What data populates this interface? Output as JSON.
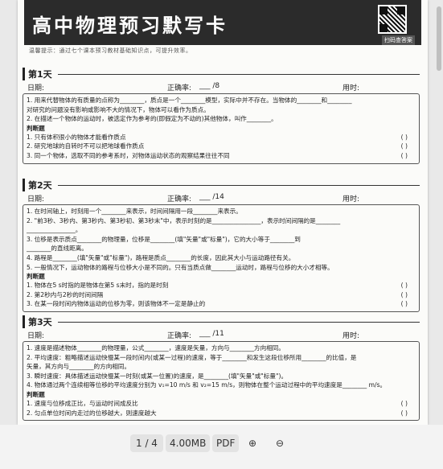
{
  "banner": {
    "title": "高中物理预习默写卡",
    "qr_caption": "扫码查答案",
    "tip": "温馨提示：通过七个课本预习教材基础知识点，可提升效率。"
  },
  "days": [
    {
      "tag": "第1天",
      "date_label": "日期:",
      "score_label": "正确率:",
      "score_value": "___ /8",
      "time_label": "用时:",
      "lines": [
        "1. 用来代替物体的有质量的点称为________，质点是一个________模型，实际中并不存在。当物体的________和________",
        "对研究的问题没有影响或影响不大的情况下，物体可以看作为质点。",
        "2. 在描述一个物体的运动时，被选定作为参考的(即假定为不动的)其他物体，叫作________。"
      ],
      "judge_label": "判断题",
      "judge": [
        "1. 只有体积很小的物体才能看作质点",
        "2. 研究地球的自转时不可以把地球看作质点",
        "3. 同一个物体，选取不同的参考系时，对物体运动状态的观察结果往往不同"
      ]
    },
    {
      "tag": "第2天",
      "date_label": "日期:",
      "score_label": "正确率:",
      "score_value": "___ /14",
      "time_label": "用时:",
      "lines": [
        "1. 在时间轴上，时刻用一个________来表示，时间间隔用一段________来表示。",
        "2. \"前3秒、3秒内、第3秒内、第3秒初、第3秒末\"中，表示时刻的是________________，表示时间间隔的是________",
        "________________。",
        "3. 位移是表示质点________的物理量，位移是________(填\"矢量\"或\"标量\")，它的大小等于________到",
        "________的直线距离。",
        "4. 路程是________(填\"矢量\"或\"标量\")，路程是质点________的长度，因此其大小与运动路径有关。",
        "5. 一般情况下，运动物体的路程与位移大小是不同的。只有当质点做________运动时，路程与位移的大小才相等。"
      ],
      "judge_label": "判断题",
      "judge": [
        "1. 物体在5 s时指的是物体在第5 s末时，指的是时刻",
        "2. 第2秒内与2秒的时间间隔",
        "3. 在某一段时间内物体运动的位移为零，则该物体不一定是静止的"
      ]
    },
    {
      "tag": "第3天",
      "date_label": "日期:",
      "score_label": "正确率:",
      "score_value": "___ /11",
      "time_label": "用时:",
      "lines": [
        "1. 速度是描述物体________的物理量，公式________，速度是矢量，方向与________方向相同。",
        "2. 平均速度：粗略描述运动快慢某一段时间内(或某一过程)的速度，等于________和发生这段位移所用________的比值，是",
        "矢量，其方向与________的方向相同。",
        "3. 瞬时速度：具体描述运动快慢某一时刻(或某一位置)的速度，是________(填\"矢量\"或\"标量\")。",
        "4. 物体通过两个连续相等位移的平均速度分别为 v₁=10 m/s 和 v₂=15 m/s，则物体在整个运动过程中的平均速度是________ m/s。"
      ],
      "judge_label": "判断题",
      "judge": [
        "1. 速度与位移成正比，与运动时间成反比",
        "2. 匀点单位时间内走过的位移越大，则速度越大"
      ]
    }
  ],
  "paren": "(    )",
  "toolbar": {
    "page": "1 / 4",
    "size": "4.00MB",
    "type": "PDF",
    "zoom_in": "⊕",
    "zoom_out": "⊖"
  }
}
